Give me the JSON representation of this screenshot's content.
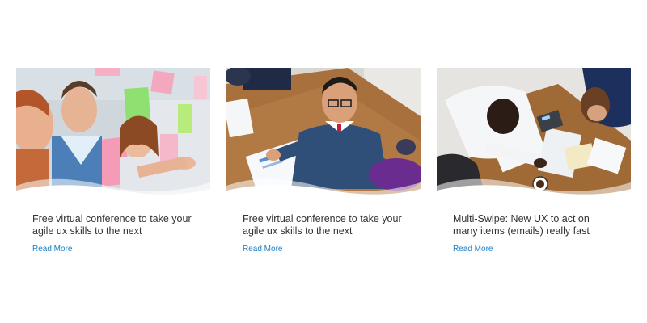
{
  "cards": [
    {
      "image_alt": "Smiling team members in front of a glass wall with sticky notes",
      "title": "Free virtual conference to take your agile ux skills to the next",
      "link_label": "Read More"
    },
    {
      "image_alt": "Man in blue sweater working over charts at a wooden meeting table",
      "title": "Free virtual conference to take your agile ux skills to the next",
      "link_label": "Read More"
    },
    {
      "image_alt": "Overhead view of colleagues reviewing papers and a notebook at a desk",
      "title": "Multi-Swipe: New UX to act on many items (emails) really fast",
      "link_label": "Read More"
    }
  ],
  "colors": {
    "title_text": "#333333",
    "link": "#1a7ec4",
    "background": "#ffffff"
  }
}
